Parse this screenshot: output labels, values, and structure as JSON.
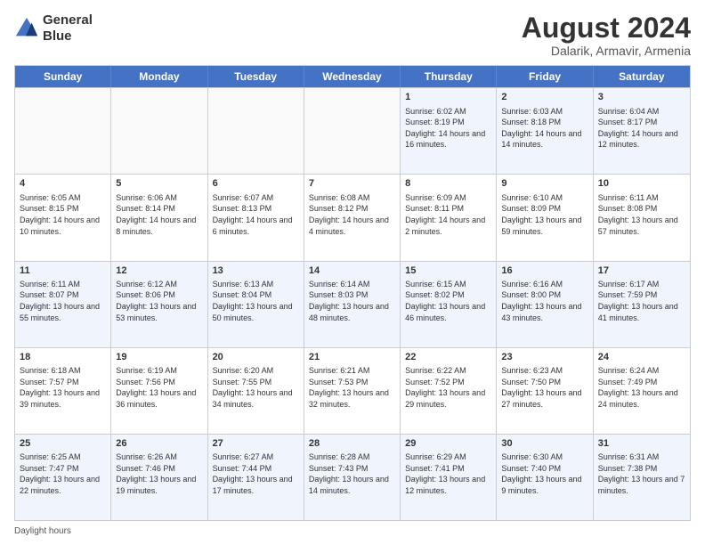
{
  "logo": {
    "line1": "General",
    "line2": "Blue"
  },
  "title": "August 2024",
  "subtitle": "Dalarik, Armavir, Armenia",
  "days_of_week": [
    "Sunday",
    "Monday",
    "Tuesday",
    "Wednesday",
    "Thursday",
    "Friday",
    "Saturday"
  ],
  "footer": "Daylight hours",
  "weeks": [
    [
      {
        "day": "",
        "info": "",
        "empty": true
      },
      {
        "day": "",
        "info": "",
        "empty": true
      },
      {
        "day": "",
        "info": "",
        "empty": true
      },
      {
        "day": "",
        "info": "",
        "empty": true
      },
      {
        "day": "1",
        "info": "Sunrise: 6:02 AM\nSunset: 8:19 PM\nDaylight: 14 hours and 16 minutes."
      },
      {
        "day": "2",
        "info": "Sunrise: 6:03 AM\nSunset: 8:18 PM\nDaylight: 14 hours and 14 minutes."
      },
      {
        "day": "3",
        "info": "Sunrise: 6:04 AM\nSunset: 8:17 PM\nDaylight: 14 hours and 12 minutes."
      }
    ],
    [
      {
        "day": "4",
        "info": "Sunrise: 6:05 AM\nSunset: 8:15 PM\nDaylight: 14 hours and 10 minutes."
      },
      {
        "day": "5",
        "info": "Sunrise: 6:06 AM\nSunset: 8:14 PM\nDaylight: 14 hours and 8 minutes."
      },
      {
        "day": "6",
        "info": "Sunrise: 6:07 AM\nSunset: 8:13 PM\nDaylight: 14 hours and 6 minutes."
      },
      {
        "day": "7",
        "info": "Sunrise: 6:08 AM\nSunset: 8:12 PM\nDaylight: 14 hours and 4 minutes."
      },
      {
        "day": "8",
        "info": "Sunrise: 6:09 AM\nSunset: 8:11 PM\nDaylight: 14 hours and 2 minutes."
      },
      {
        "day": "9",
        "info": "Sunrise: 6:10 AM\nSunset: 8:09 PM\nDaylight: 13 hours and 59 minutes."
      },
      {
        "day": "10",
        "info": "Sunrise: 6:11 AM\nSunset: 8:08 PM\nDaylight: 13 hours and 57 minutes."
      }
    ],
    [
      {
        "day": "11",
        "info": "Sunrise: 6:11 AM\nSunset: 8:07 PM\nDaylight: 13 hours and 55 minutes."
      },
      {
        "day": "12",
        "info": "Sunrise: 6:12 AM\nSunset: 8:06 PM\nDaylight: 13 hours and 53 minutes."
      },
      {
        "day": "13",
        "info": "Sunrise: 6:13 AM\nSunset: 8:04 PM\nDaylight: 13 hours and 50 minutes."
      },
      {
        "day": "14",
        "info": "Sunrise: 6:14 AM\nSunset: 8:03 PM\nDaylight: 13 hours and 48 minutes."
      },
      {
        "day": "15",
        "info": "Sunrise: 6:15 AM\nSunset: 8:02 PM\nDaylight: 13 hours and 46 minutes."
      },
      {
        "day": "16",
        "info": "Sunrise: 6:16 AM\nSunset: 8:00 PM\nDaylight: 13 hours and 43 minutes."
      },
      {
        "day": "17",
        "info": "Sunrise: 6:17 AM\nSunset: 7:59 PM\nDaylight: 13 hours and 41 minutes."
      }
    ],
    [
      {
        "day": "18",
        "info": "Sunrise: 6:18 AM\nSunset: 7:57 PM\nDaylight: 13 hours and 39 minutes."
      },
      {
        "day": "19",
        "info": "Sunrise: 6:19 AM\nSunset: 7:56 PM\nDaylight: 13 hours and 36 minutes."
      },
      {
        "day": "20",
        "info": "Sunrise: 6:20 AM\nSunset: 7:55 PM\nDaylight: 13 hours and 34 minutes."
      },
      {
        "day": "21",
        "info": "Sunrise: 6:21 AM\nSunset: 7:53 PM\nDaylight: 13 hours and 32 minutes."
      },
      {
        "day": "22",
        "info": "Sunrise: 6:22 AM\nSunset: 7:52 PM\nDaylight: 13 hours and 29 minutes."
      },
      {
        "day": "23",
        "info": "Sunrise: 6:23 AM\nSunset: 7:50 PM\nDaylight: 13 hours and 27 minutes."
      },
      {
        "day": "24",
        "info": "Sunrise: 6:24 AM\nSunset: 7:49 PM\nDaylight: 13 hours and 24 minutes."
      }
    ],
    [
      {
        "day": "25",
        "info": "Sunrise: 6:25 AM\nSunset: 7:47 PM\nDaylight: 13 hours and 22 minutes."
      },
      {
        "day": "26",
        "info": "Sunrise: 6:26 AM\nSunset: 7:46 PM\nDaylight: 13 hours and 19 minutes."
      },
      {
        "day": "27",
        "info": "Sunrise: 6:27 AM\nSunset: 7:44 PM\nDaylight: 13 hours and 17 minutes."
      },
      {
        "day": "28",
        "info": "Sunrise: 6:28 AM\nSunset: 7:43 PM\nDaylight: 13 hours and 14 minutes."
      },
      {
        "day": "29",
        "info": "Sunrise: 6:29 AM\nSunset: 7:41 PM\nDaylight: 13 hours and 12 minutes."
      },
      {
        "day": "30",
        "info": "Sunrise: 6:30 AM\nSunset: 7:40 PM\nDaylight: 13 hours and 9 minutes."
      },
      {
        "day": "31",
        "info": "Sunrise: 6:31 AM\nSunset: 7:38 PM\nDaylight: 13 hours and 7 minutes."
      }
    ]
  ]
}
